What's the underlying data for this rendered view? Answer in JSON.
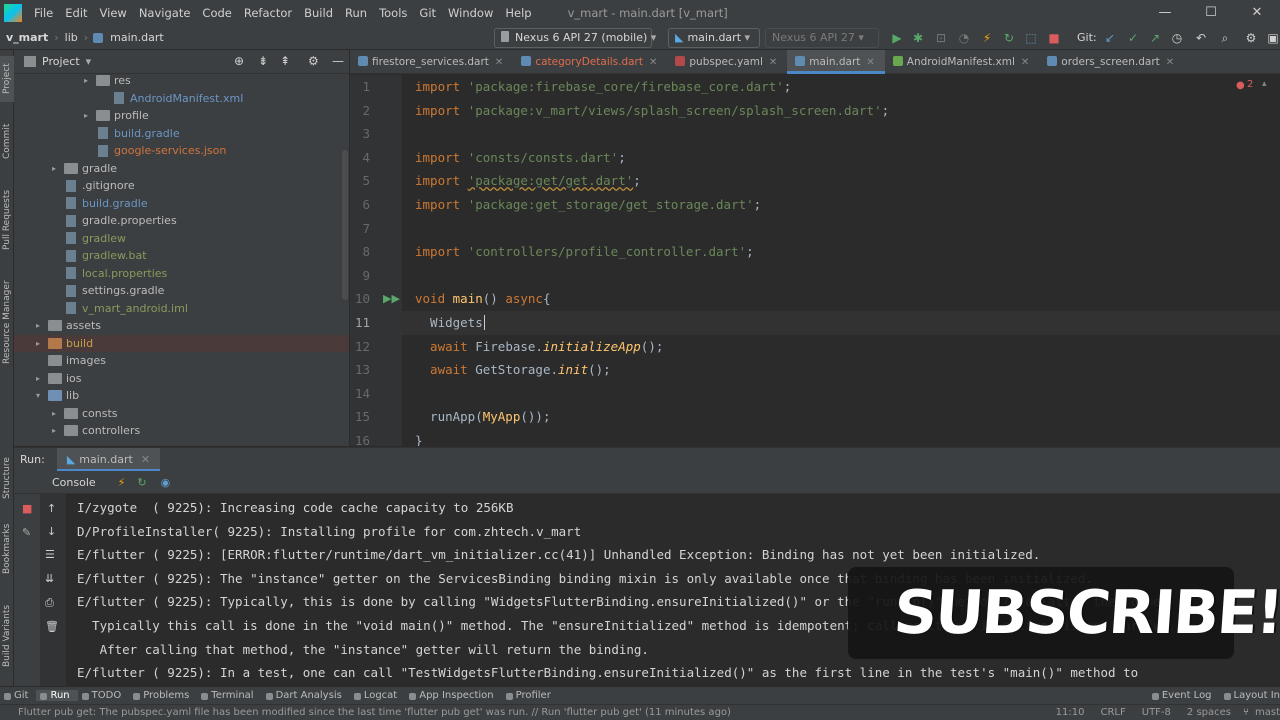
{
  "menubar": {
    "items": [
      "File",
      "Edit",
      "View",
      "Navigate",
      "Code",
      "Refactor",
      "Build",
      "Run",
      "Tools",
      "Git",
      "Window",
      "Help"
    ],
    "title": "v_mart - main.dart [v_mart]"
  },
  "navbar": {
    "breadcrumbs": [
      "v_mart",
      "lib",
      "main.dart"
    ],
    "device_combo": "Nexus 6 API 27 (mobile)",
    "config_combo": "main.dart",
    "target_combo": "Nexus 6 API 27",
    "git_label": "Git:"
  },
  "project": {
    "title": "Project",
    "items": [
      {
        "label": "res",
        "color": "#bbbbbb"
      },
      {
        "label": "AndroidManifest.xml",
        "color": "#6b96c4"
      },
      {
        "label": "profile",
        "color": "#bbbbbb"
      },
      {
        "label": "build.gradle",
        "color": "#6b96c4"
      },
      {
        "label": "google-services.json",
        "color": "#d0743c"
      },
      {
        "label": "gradle",
        "color": "#bbbbbb"
      },
      {
        "label": ".gitignore",
        "color": "#bbbbbb"
      },
      {
        "label": "build.gradle",
        "color": "#6b96c4"
      },
      {
        "label": "gradle.properties",
        "color": "#bbbbbb"
      },
      {
        "label": "gradlew",
        "color": "#8a9a5b"
      },
      {
        "label": "gradlew.bat",
        "color": "#8a9a5b"
      },
      {
        "label": "local.properties",
        "color": "#8a9a5b"
      },
      {
        "label": "settings.gradle",
        "color": "#bbbbbb"
      },
      {
        "label": "v_mart_android.iml",
        "color": "#8a9a5b"
      },
      {
        "label": "assets",
        "color": "#bbbbbb"
      },
      {
        "label": "build",
        "color": "#c8a046"
      },
      {
        "label": "images",
        "color": "#bbbbbb"
      },
      {
        "label": "ios",
        "color": "#bbbbbb"
      },
      {
        "label": "lib",
        "color": "#bbbbbb"
      },
      {
        "label": "consts",
        "color": "#bbbbbb"
      },
      {
        "label": "controllers",
        "color": "#bbbbbb"
      }
    ]
  },
  "left_tools": [
    "Project",
    "Commit",
    "Pull Requests",
    "Resource Manager",
    "Structure",
    "Bookmarks",
    "Build Variants"
  ],
  "editor_tabs": [
    {
      "label": "firestore_services.dart",
      "color": "#bbbbbb"
    },
    {
      "label": "categoryDetails.dart",
      "color": "#e06c4a"
    },
    {
      "label": "pubspec.yaml",
      "color": "#bbbbbb"
    },
    {
      "label": "main.dart",
      "color": "#bbbbbb"
    },
    {
      "label": "AndroidManifest.xml",
      "color": "#bbbbbb"
    },
    {
      "label": "orders_screen.dart",
      "color": "#bbbbbb"
    }
  ],
  "error_count": "2",
  "code_lines": [
    {
      "n": "1",
      "parts": [
        [
          "kw",
          "import "
        ],
        [
          "str",
          "'package:firebase_core/firebase_core.dart'"
        ],
        [
          "",
          "; "
        ]
      ]
    },
    {
      "n": "2",
      "parts": [
        [
          "kw",
          "import "
        ],
        [
          "str",
          "'package:v_mart/views/splash_screen/splash_screen.dart'"
        ],
        [
          "",
          ";"
        ]
      ]
    },
    {
      "n": "3",
      "parts": []
    },
    {
      "n": "4",
      "parts": [
        [
          "kw",
          "import "
        ],
        [
          "str",
          "'consts/consts.dart'"
        ],
        [
          "",
          ";"
        ]
      ]
    },
    {
      "n": "5",
      "parts": [
        [
          "kw",
          "import "
        ],
        [
          "str",
          "'package:get/get.dart'"
        ],
        [
          "",
          ";"
        ]
      ]
    },
    {
      "n": "6",
      "parts": [
        [
          "kw",
          "import "
        ],
        [
          "str",
          "'package:get_storage/get_storage.dart'"
        ],
        [
          "",
          ";"
        ]
      ]
    },
    {
      "n": "7",
      "parts": []
    },
    {
      "n": "8",
      "parts": [
        [
          "kw",
          "import "
        ],
        [
          "str",
          "'controllers/profile_controller.dart'"
        ],
        [
          "",
          ";"
        ]
      ]
    },
    {
      "n": "9",
      "parts": []
    },
    {
      "n": "10",
      "parts": [
        [
          "kw",
          "void "
        ],
        [
          "fn",
          "main"
        ],
        [
          "",
          "() "
        ],
        [
          "kw",
          "async"
        ],
        [
          "",
          "{"
        ]
      ]
    },
    {
      "n": "11",
      "parts": [
        [
          "",
          "  Widgets"
        ]
      ]
    },
    {
      "n": "12",
      "parts": [
        [
          "kw",
          "  await "
        ],
        [
          "",
          "Firebase."
        ],
        [
          "it",
          "initializeApp"
        ],
        [
          "",
          "();"
        ]
      ]
    },
    {
      "n": "13",
      "parts": [
        [
          "kw",
          "  await "
        ],
        [
          "",
          "GetStorage."
        ],
        [
          "it",
          "init"
        ],
        [
          "",
          "();"
        ]
      ]
    },
    {
      "n": "14",
      "parts": []
    },
    {
      "n": "15",
      "parts": [
        [
          "",
          "  runApp("
        ],
        [
          "fn",
          "MyApp"
        ],
        [
          "",
          "());"
        ]
      ]
    },
    {
      "n": "16",
      "parts": [
        [
          "",
          "}"
        ]
      ]
    }
  ],
  "run": {
    "label": "Run:",
    "tab": "main.dart",
    "console_tab": "Console",
    "log_lines": [
      "I/zygote  ( 9225): Increasing code cache capacity to 256KB",
      "D/ProfileInstaller( 9225): Installing profile for com.zhtech.v_mart",
      "E/flutter ( 9225): [ERROR:flutter/runtime/dart_vm_initializer.cc(41)] Unhandled Exception: Binding has not yet been initialized.",
      "E/flutter ( 9225): The \"instance\" getter on the ServicesBinding binding mixin is only available once that binding has been initialized.",
      "E/flutter ( 9225): Typically, this is done by calling \"WidgetsFlutterBinding.ensureInitialized()\" or the \"runApp()\" method (the latter the former).",
      "  Typically this call is done in the \"void main()\" method. The \"ensureInitialized\" method is idempotent; calling it multiple times is not harmful.",
      "   After calling that method, the \"instance\" getter will return the binding.",
      "E/flutter ( 9225): In a test, one can call \"TestWidgetsFlutterBinding.ensureInitialized()\" as the first line in the test's \"main()\" method to"
    ]
  },
  "bottom_tools": [
    "Git",
    "Run",
    "TODO",
    "Problems",
    "Terminal",
    "Dart Analysis",
    "Logcat",
    "App Inspection",
    "Profiler"
  ],
  "bottom_tools_right": [
    "Event Log",
    "Layout In"
  ],
  "status": {
    "message": "Flutter pub get: The pubspec.yaml file has been modified since the last time 'flutter pub get' was run. // Run 'flutter pub get' (11 minutes ago)",
    "position": "11:10",
    "line_sep": "CRLF",
    "encoding": "UTF-8",
    "indent": "2 spaces",
    "branch": "mast"
  },
  "overlay": {
    "text": "SUBSCRIBE!"
  }
}
